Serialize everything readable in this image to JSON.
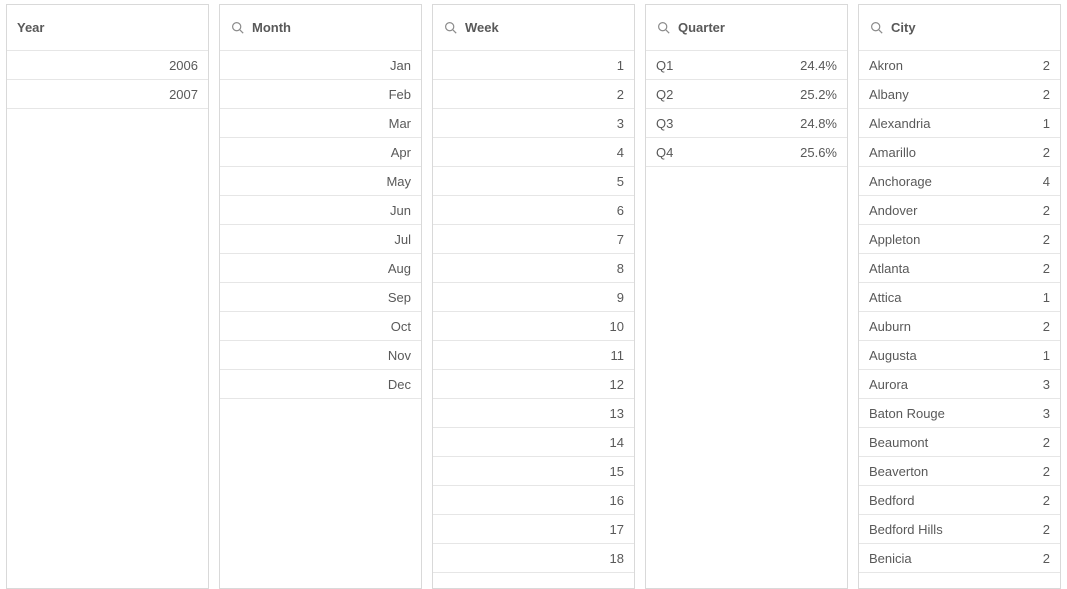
{
  "panels": {
    "year": {
      "title": "Year",
      "searchable": false,
      "align": "right",
      "items": [
        "2006",
        "2007"
      ]
    },
    "month": {
      "title": "Month",
      "searchable": true,
      "align": "right",
      "items": [
        "Jan",
        "Feb",
        "Mar",
        "Apr",
        "May",
        "Jun",
        "Jul",
        "Aug",
        "Sep",
        "Oct",
        "Nov",
        "Dec"
      ]
    },
    "week": {
      "title": "Week",
      "searchable": true,
      "align": "right",
      "items": [
        "1",
        "2",
        "3",
        "4",
        "5",
        "6",
        "7",
        "8",
        "9",
        "10",
        "11",
        "12",
        "13",
        "14",
        "15",
        "16",
        "17",
        "18"
      ]
    },
    "quarter": {
      "title": "Quarter",
      "searchable": true,
      "align": "split",
      "items": [
        {
          "label": "Q1",
          "value": "24.4%"
        },
        {
          "label": "Q2",
          "value": "25.2%"
        },
        {
          "label": "Q3",
          "value": "24.8%"
        },
        {
          "label": "Q4",
          "value": "25.6%"
        }
      ]
    },
    "city": {
      "title": "City",
      "searchable": true,
      "align": "split",
      "items": [
        {
          "label": "Akron",
          "value": "2"
        },
        {
          "label": "Albany",
          "value": "2"
        },
        {
          "label": "Alexandria",
          "value": "1"
        },
        {
          "label": "Amarillo",
          "value": "2"
        },
        {
          "label": "Anchorage",
          "value": "4"
        },
        {
          "label": "Andover",
          "value": "2"
        },
        {
          "label": "Appleton",
          "value": "2"
        },
        {
          "label": "Atlanta",
          "value": "2"
        },
        {
          "label": "Attica",
          "value": "1"
        },
        {
          "label": "Auburn",
          "value": "2"
        },
        {
          "label": "Augusta",
          "value": "1"
        },
        {
          "label": "Aurora",
          "value": "3"
        },
        {
          "label": "Baton Rouge",
          "value": "3"
        },
        {
          "label": "Beaumont",
          "value": "2"
        },
        {
          "label": "Beaverton",
          "value": "2"
        },
        {
          "label": "Bedford",
          "value": "2"
        },
        {
          "label": "Bedford Hills",
          "value": "2"
        },
        {
          "label": "Benicia",
          "value": "2"
        }
      ]
    }
  },
  "panel_order": [
    "year",
    "month",
    "week",
    "quarter",
    "city"
  ]
}
